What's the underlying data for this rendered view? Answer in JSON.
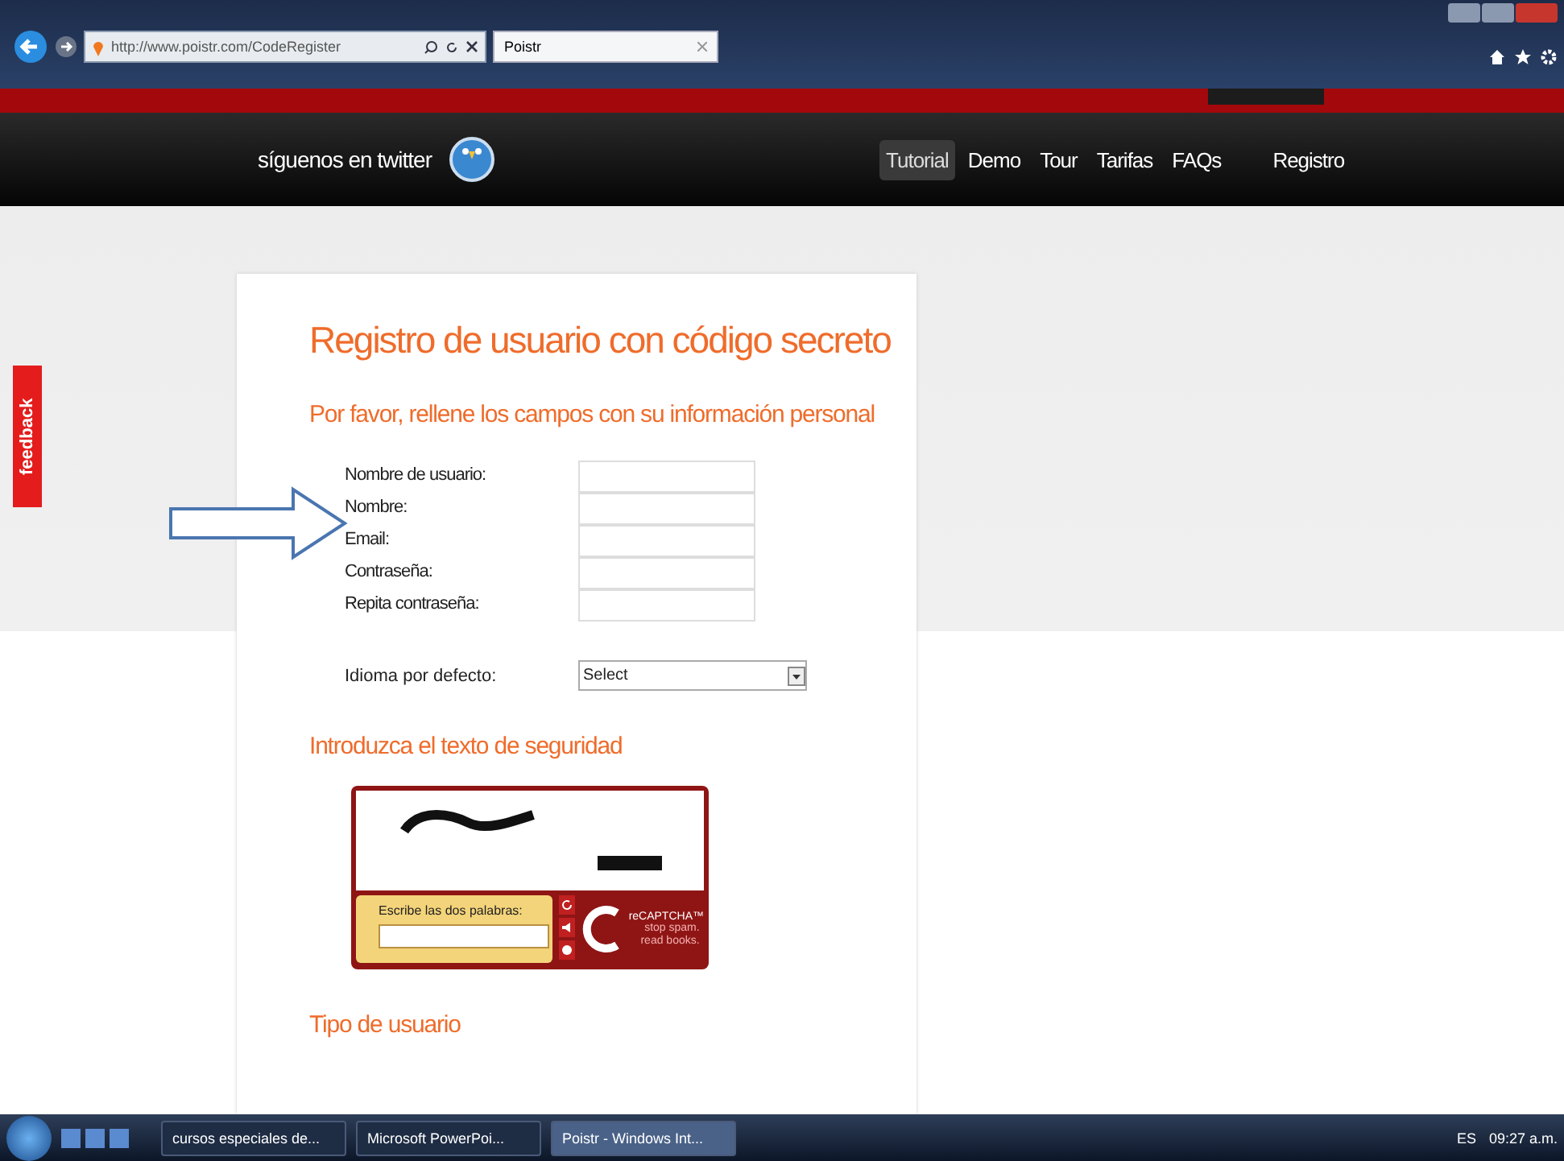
{
  "browser": {
    "url": "http://www.poistr.com/CodeRegister",
    "tab_title": "Poistr"
  },
  "site": {
    "twitter_text": "síguenos en twitter",
    "nav": [
      {
        "label": "Tutorial",
        "selected": true
      },
      {
        "label": "Demo",
        "selected": false
      },
      {
        "label": "Tour",
        "selected": false
      },
      {
        "label": "Tarifas",
        "selected": false
      },
      {
        "label": "FAQs",
        "selected": false
      },
      {
        "label": "Registro",
        "selected": false
      }
    ]
  },
  "feedback": "feedback",
  "form": {
    "title": "Registro de usuario con código secreto",
    "subtitle": "Por favor, rellene los campos con su información personal",
    "fields": [
      {
        "label": "Nombre de usuario:"
      },
      {
        "label": "Nombre:"
      },
      {
        "label": "Email:"
      },
      {
        "label": "Contraseña:"
      },
      {
        "label": "Repita contraseña:"
      }
    ],
    "language": {
      "label": "Idioma por defecto:",
      "value": "Select"
    },
    "security_heading": "Introduzca el texto de seguridad",
    "captcha": {
      "prompt": "Escribe las dos palabras:",
      "logo": "reCAPTCHA™",
      "tagline": "stop spam. read books."
    },
    "next_heading": "Tipo de usuario"
  },
  "taskbar": {
    "items": [
      {
        "label": "cursos especiales de...",
        "selected": false
      },
      {
        "label": "Microsoft PowerPoi...",
        "selected": false
      },
      {
        "label": "Poistr - Windows Int...",
        "selected": true
      }
    ],
    "language": "ES",
    "clock": "09:27 a.m."
  }
}
